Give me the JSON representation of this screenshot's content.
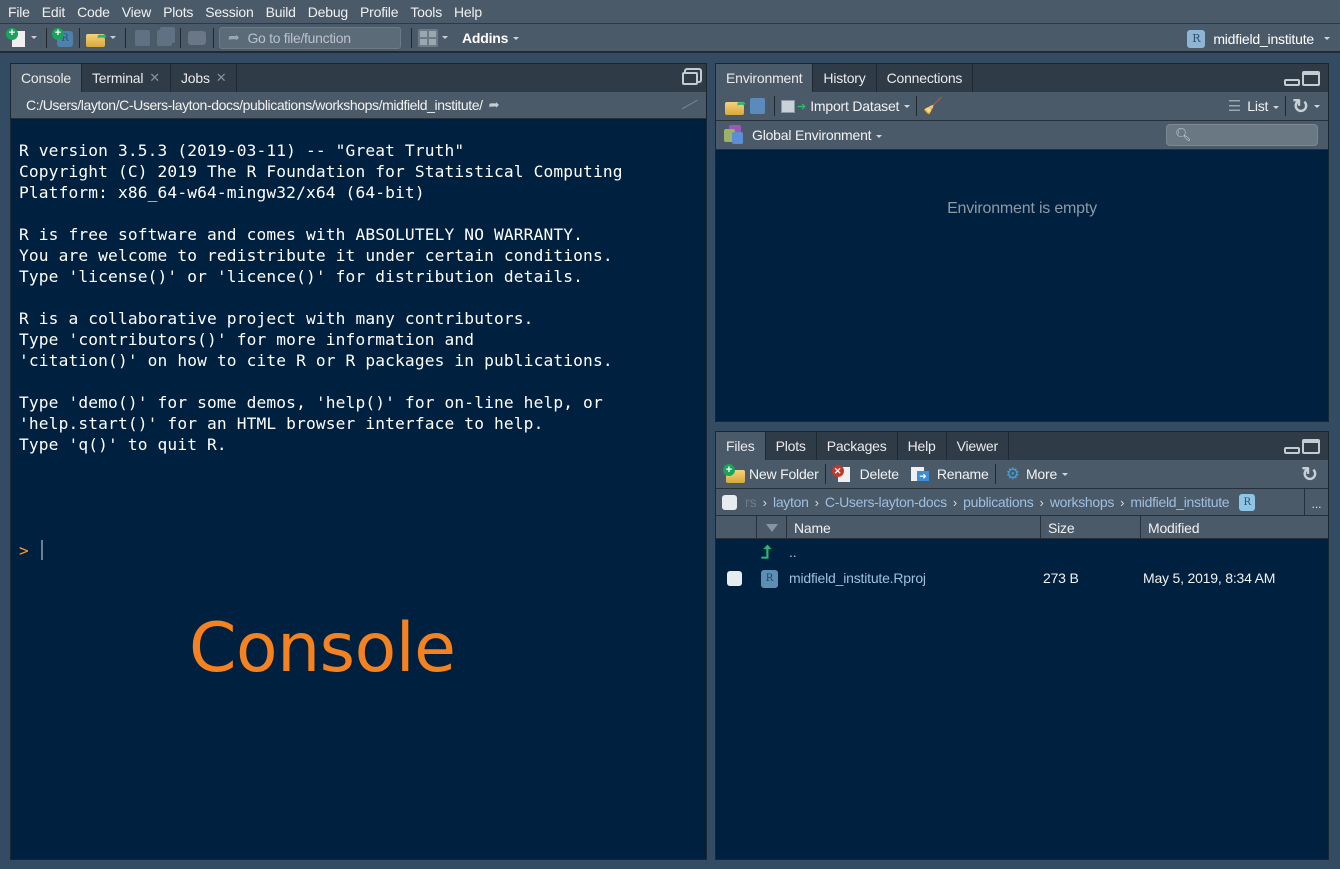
{
  "menubar": {
    "items": [
      "File",
      "Edit",
      "Code",
      "View",
      "Plots",
      "Session",
      "Build",
      "Debug",
      "Profile",
      "Tools",
      "Help"
    ]
  },
  "toolbar": {
    "goto_placeholder": "Go to file/function",
    "addins_label": "Addins",
    "project_name": "midfield_institute",
    "icons": [
      "new-file-icon",
      "new-project-icon",
      "open-file-icon",
      "save-icon",
      "save-all-icon",
      "print-icon",
      "workspace-panes-icon"
    ]
  },
  "console_pane": {
    "tabs": [
      {
        "label": "Console",
        "closable": false,
        "active": true
      },
      {
        "label": "Terminal",
        "closable": true,
        "active": false
      },
      {
        "label": "Jobs",
        "closable": true,
        "active": false
      }
    ],
    "working_directory": "C:/Users/layton/C-Users-layton-docs/publications/workshops/midfield_institute/",
    "startup_text": "R version 3.5.3 (2019-03-11) -- \"Great Truth\"\nCopyright (C) 2019 The R Foundation for Statistical Computing\nPlatform: x86_64-w64-mingw32/x64 (64-bit)\n\nR is free software and comes with ABSOLUTELY NO WARRANTY.\nYou are welcome to redistribute it under certain conditions.\nType 'license()' or 'licence()' for distribution details.\n\nR is a collaborative project with many contributors.\nType 'contributors()' for more information and\n'citation()' on how to cite R or R packages in publications.\n\nType 'demo()' for some demos, 'help()' for on-line help, or\n'help.start()' for an HTML browser interface to help.\nType 'q()' to quit R.",
    "prompt": ">",
    "annotation_label": "Console",
    "annotation_color": "#f58220"
  },
  "environment_pane": {
    "tabs": [
      {
        "label": "Environment",
        "active": true
      },
      {
        "label": "History",
        "active": false
      },
      {
        "label": "Connections",
        "active": false
      }
    ],
    "import_dataset_label": "Import Dataset",
    "view_mode_label": "List",
    "scope_label": "Global Environment",
    "search_placeholder": "",
    "empty_message": "Environment is empty"
  },
  "files_pane": {
    "tabs": [
      {
        "label": "Files",
        "active": true
      },
      {
        "label": "Plots",
        "active": false
      },
      {
        "label": "Packages",
        "active": false
      },
      {
        "label": "Help",
        "active": false
      },
      {
        "label": "Viewer",
        "active": false
      }
    ],
    "toolbar": {
      "new_folder": "New Folder",
      "delete": "Delete",
      "rename": "Rename",
      "more": "More"
    },
    "breadcrumb": {
      "truncated": "rs",
      "items": [
        "layton",
        "C-Users-layton-docs",
        "publications",
        "workshops",
        "midfield_institute"
      ],
      "overflow": "..."
    },
    "columns": [
      "Name",
      "Size",
      "Modified"
    ],
    "parent_dir_label": "..",
    "rows": [
      {
        "name": "midfield_institute.Rproj",
        "size": "273 B",
        "modified": "May 5, 2019, 8:34 AM",
        "type": "rproj"
      }
    ]
  },
  "colors": {
    "background": "#334b63",
    "pane_bg": "#00203f",
    "toolbar_bg": "#4b5a68",
    "prompt": "#ff9d26",
    "link": "#9ebfe0"
  }
}
